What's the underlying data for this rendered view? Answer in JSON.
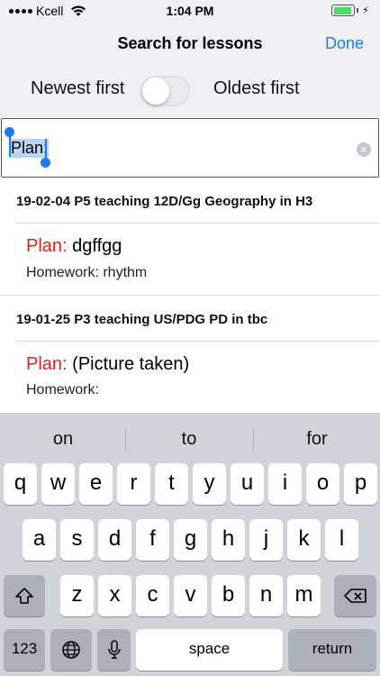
{
  "status_bar": {
    "carrier": "Kcell",
    "time": "1:04 PM",
    "battery_level": 0.9
  },
  "nav": {
    "title": "Search for lessons",
    "done_label": "Done"
  },
  "sort": {
    "left_label": "Newest first",
    "right_label": "Oldest first",
    "toggle_on": false
  },
  "search": {
    "value": "Plan:"
  },
  "results": [
    {
      "header": "19-02-04 P5 teaching 12D/Gg Geography in H3",
      "plan_label": "Plan:",
      "plan_text": "dgffgg",
      "homework": "Homework: rhythm"
    },
    {
      "header": "19-01-25 P3 teaching US/PDG PD in tbc",
      "plan_label": "Plan:",
      "plan_text": "(Picture taken)",
      "homework": "Homework:"
    }
  ],
  "keyboard": {
    "suggestions": [
      "on",
      "to",
      "for"
    ],
    "row1": [
      "q",
      "w",
      "e",
      "r",
      "t",
      "y",
      "u",
      "i",
      "o",
      "p"
    ],
    "row2": [
      "a",
      "s",
      "d",
      "f",
      "g",
      "h",
      "j",
      "k",
      "l"
    ],
    "row3": [
      "z",
      "x",
      "c",
      "v",
      "b",
      "n",
      "m"
    ],
    "numbers_label": "123",
    "space_label": "space",
    "return_label": "return"
  },
  "icons": {
    "wifi": "wifi-icon",
    "battery": "battery-icon",
    "charging": "bolt-icon",
    "clear": "clear-icon",
    "shift": "shift-icon",
    "backspace": "backspace-icon",
    "globe": "globe-icon",
    "mic": "microphone-icon"
  },
  "colors": {
    "accent": "#1a7cf5",
    "plan_label": "#e0211b",
    "battery": "#4cd964"
  }
}
